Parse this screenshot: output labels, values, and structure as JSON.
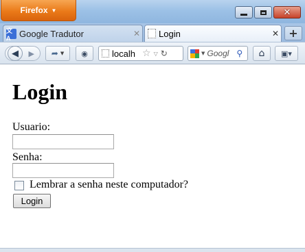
{
  "app": {
    "menu_button_label": "Firefox"
  },
  "tabs": [
    {
      "label": "Google Tradutor",
      "icon": "google-translate-icon",
      "active": false
    },
    {
      "label": "Login",
      "icon": "blank-page-icon",
      "active": true
    }
  ],
  "toolbar": {
    "url": "localh",
    "search_engine": "Google",
    "search_placeholder": "Googl"
  },
  "page": {
    "title": "Login",
    "username_label": "Usuario:",
    "username_value": "",
    "password_label": "Senha:",
    "password_value": "",
    "remember_label": "Lembrar a senha neste computador?",
    "remember_checked": false,
    "login_button": "Login"
  },
  "colors": {
    "firefox_button": "#ea7a19",
    "titlebar": "#9cc1e6",
    "close_button": "#c7432a"
  }
}
